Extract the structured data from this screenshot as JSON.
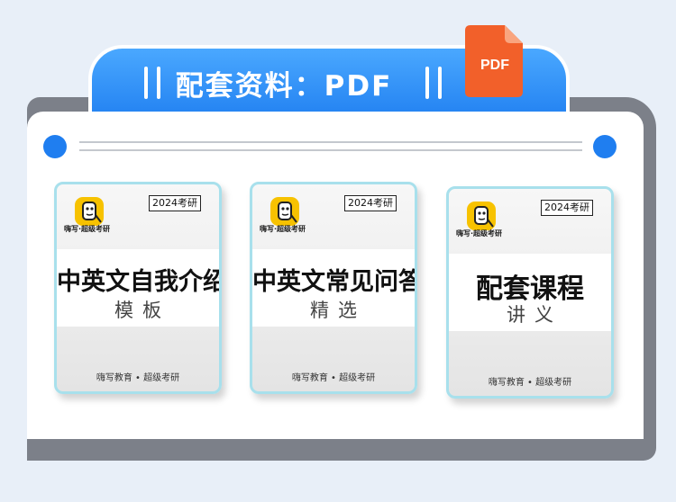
{
  "header": {
    "title": "配套资料：PDF",
    "badge_label": "PDF"
  },
  "documents": [
    {
      "year_tag": "2024考研",
      "brand": "嗨写·超级考研",
      "title": "中英文自我介绍",
      "subtitle": "模板",
      "footer": "嗨写教育 • 超级考研"
    },
    {
      "year_tag": "2024考研",
      "brand": "嗨写·超级考研",
      "title": "中英文常见问答",
      "subtitle": "精选",
      "footer": "嗨写教育 • 超级考研"
    },
    {
      "year_tag": "2024考研",
      "brand": "嗨写·超级考研",
      "title": "配套课程",
      "subtitle": "讲义",
      "footer": "嗨写教育 • 超级考研"
    }
  ],
  "colors": {
    "accent_blue": "#1f7ef0",
    "pdf_orange": "#f2602a",
    "logo_yellow": "#f7c200",
    "thumb_border": "#a8e0ec"
  },
  "icons": [
    "pdf-file-icon",
    "brand-logo-icon"
  ]
}
